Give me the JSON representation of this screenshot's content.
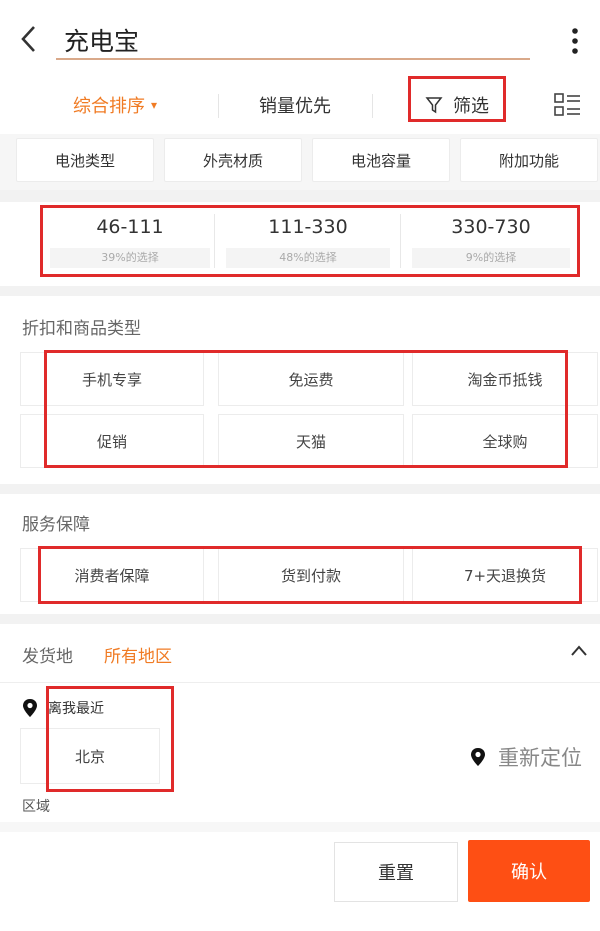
{
  "search": {
    "query": "充电宝"
  },
  "sort_bar": {
    "items": [
      {
        "label": "综合排序",
        "active": true,
        "caret": "▾"
      },
      {
        "label": "销量优先",
        "active": false
      },
      {
        "label": "筛选",
        "active": false
      }
    ]
  },
  "property_tabs": [
    "电池类型",
    "外壳材质",
    "电池容量",
    "附加功能"
  ],
  "price_ranges": [
    {
      "range": "46-111",
      "percent": "39%的选择"
    },
    {
      "range": "111-330",
      "percent": "48%的选择"
    },
    {
      "range": "330-730",
      "percent": "9%的选择"
    }
  ],
  "discount_section": {
    "title": "折扣和商品类型",
    "options": [
      "手机专享",
      "免运费",
      "淘金币抵钱",
      "促销",
      "天猫",
      "全球购"
    ]
  },
  "service_section": {
    "title": "服务保障",
    "options": [
      "消费者保障",
      "货到付款",
      "7+天退换货"
    ]
  },
  "shipping": {
    "label": "发货地",
    "value": "所有地区",
    "nearby_label": "离我最近",
    "nearby_city": "北京",
    "relocate_label": "重新定位",
    "area_label": "区域"
  },
  "footer": {
    "reset_label": "重置",
    "confirm_label": "确认"
  },
  "colors": {
    "accent": "#f07b24",
    "confirm": "#fe4f14",
    "highlight_border": "#e02a2a"
  },
  "icons": [
    "back-arrow-icon",
    "more-vertical-icon",
    "filter-funnel-icon",
    "list-view-icon",
    "location-pin-icon",
    "chevron-up-icon"
  ]
}
